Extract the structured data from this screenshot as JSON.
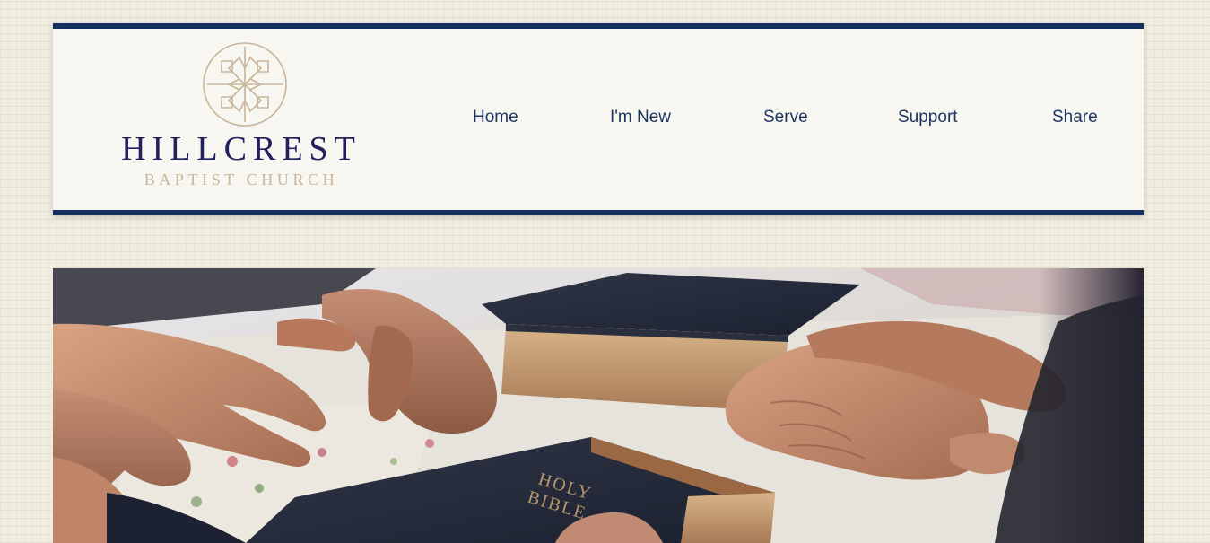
{
  "site": {
    "name_line1": "HILLCREST",
    "name_line2": "BAPTIST CHURCH",
    "logo_icon": "cross-ornament-icon"
  },
  "nav": {
    "items": [
      {
        "label": "Home"
      },
      {
        "label": "I'm New"
      },
      {
        "label": "Serve"
      },
      {
        "label": "Support"
      },
      {
        "label": "Share"
      }
    ]
  },
  "hero": {
    "book_title_line1": "HOLY",
    "book_title_line2": "BIBLE"
  },
  "colors": {
    "navy": "#13305f",
    "logo_title": "#23205e",
    "logo_gold": "#c8b59a",
    "nav_text": "#1d3661",
    "page_bg": "#efece0"
  }
}
